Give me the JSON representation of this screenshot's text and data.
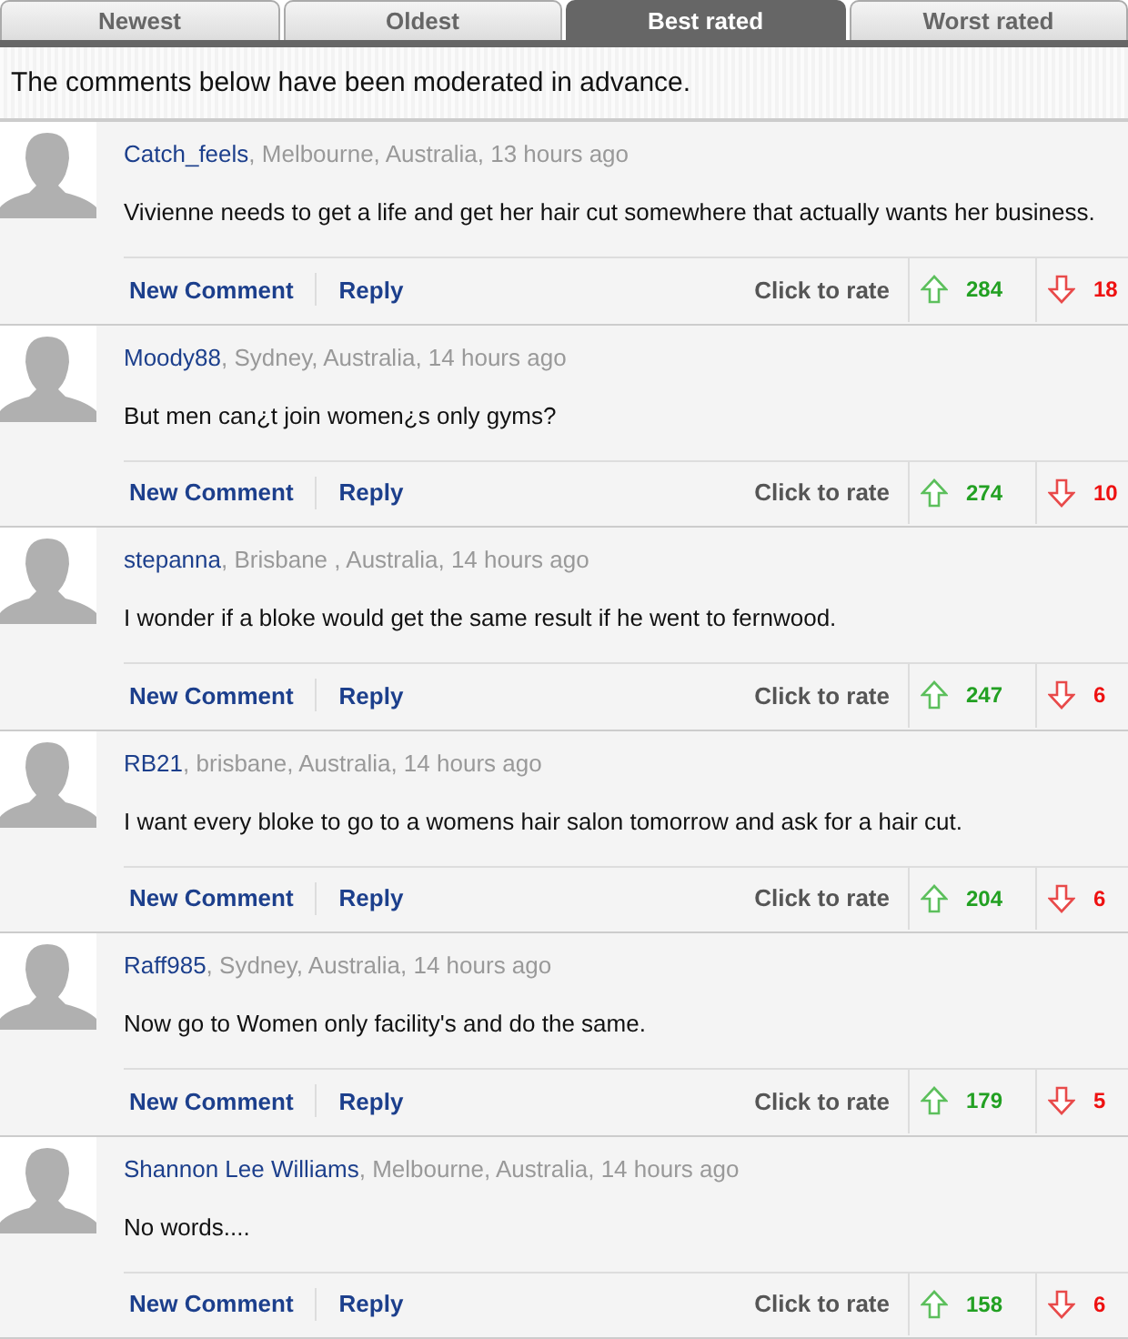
{
  "tabs": [
    {
      "label": "Newest",
      "selected": false
    },
    {
      "label": "Oldest",
      "selected": false
    },
    {
      "label": "Best rated",
      "selected": true
    },
    {
      "label": "Worst rated",
      "selected": false
    }
  ],
  "notice": "The comments below have been moderated in advance.",
  "comments": [
    {
      "user": "Catch_feels",
      "meta": ", Melbourne, Australia, 13 hours ago",
      "text": "Vivienne needs to get a life and get her hair cut somewhere that actually wants her business.",
      "new_comment": "New Comment",
      "reply": "Reply",
      "rate_label": "Click to rate",
      "up": "284",
      "down": "18"
    },
    {
      "user": "Moody88",
      "meta": ", Sydney, Australia, 14 hours ago",
      "text": "But men can¿t join women¿s only gyms?",
      "new_comment": "New Comment",
      "reply": "Reply",
      "rate_label": "Click to rate",
      "up": "274",
      "down": "10"
    },
    {
      "user": "stepanna",
      "meta": ", Brisbane , Australia, 14 hours ago",
      "text": "I wonder if a bloke would get the same result if he went to fernwood.",
      "new_comment": "New Comment",
      "reply": "Reply",
      "rate_label": "Click to rate",
      "up": "247",
      "down": "6"
    },
    {
      "user": "RB21",
      "meta": ", brisbane, Australia, 14 hours ago",
      "text": "I want every bloke to go to a womens hair salon tomorrow and ask for a hair cut.",
      "new_comment": "New Comment",
      "reply": "Reply",
      "rate_label": "Click to rate",
      "up": "204",
      "down": "6"
    },
    {
      "user": "Raff985",
      "meta": ", Sydney, Australia, 14 hours ago",
      "text": "Now go to Women only facility's and do the same.",
      "new_comment": "New Comment",
      "reply": "Reply",
      "rate_label": "Click to rate",
      "up": "179",
      "down": "5"
    },
    {
      "user": "Shannon Lee Williams",
      "meta": ", Melbourne, Australia, 14 hours ago",
      "text": "No words....",
      "new_comment": "New Comment",
      "reply": "Reply",
      "rate_label": "Click to rate",
      "up": "158",
      "down": "6"
    }
  ]
}
